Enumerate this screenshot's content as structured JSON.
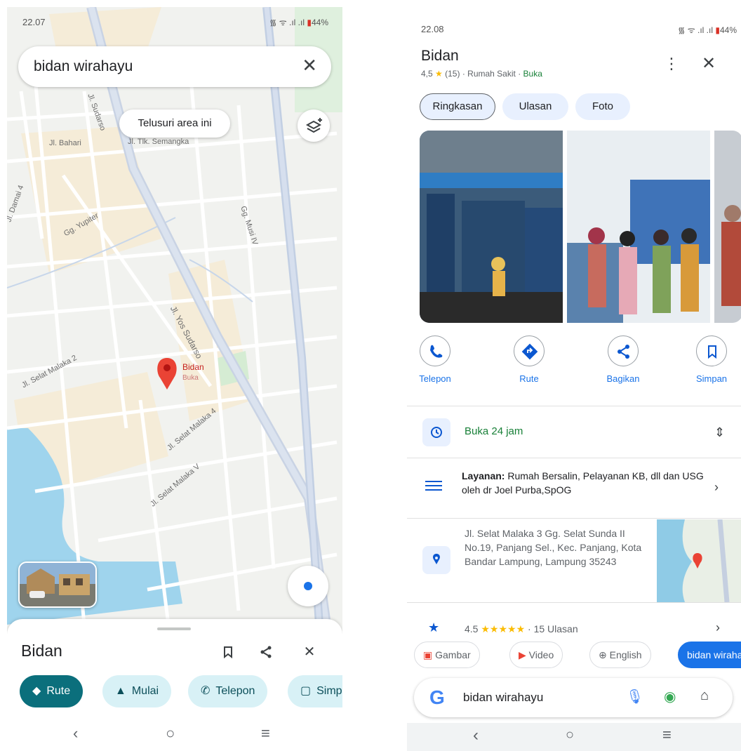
{
  "left": {
    "status": {
      "time": "22.07",
      "icons": "᯾ ᯤ .ıl .ıl",
      "battery": "44%"
    },
    "search": {
      "query": "bidan wirahayu"
    },
    "search_area_label": "Telusuri area ini",
    "street_labels": [
      "Jl. Bahari",
      "Jl. Tlk. Semangka",
      "Gg. Yupiter",
      "Gg. Musi IV",
      "Jl. Yos Sudarso",
      "Jl. Selat Malaka 2",
      "Jl. Selat Malaka 4",
      "Jl. Selat Malaka V",
      "Jl. Selat Malaka",
      "Jl. Damai 4",
      "Jl. Sudarso"
    ],
    "pin": {
      "name": "Bidan",
      "status": "Buka"
    },
    "sheet": {
      "title": "Bidan",
      "chips": [
        "Rute",
        "Mulai",
        "Telepon",
        "Simpan"
      ]
    }
  },
  "right": {
    "status": {
      "time": "22.08",
      "icons": "᯾ ᯤ .ıl .ıl",
      "battery": "44%"
    },
    "place": {
      "name": "Bidan",
      "rating": "4,5",
      "reviews_count": "(15)",
      "category": "Rumah Sakit",
      "open_status": "Buka"
    },
    "tabs": [
      "Ringkasan",
      "Ulasan",
      "Foto"
    ],
    "actions": [
      "Telepon",
      "Rute",
      "Bagikan",
      "Simpan"
    ],
    "hours": "Buka 24 jam",
    "services_label": "Layanan:",
    "services_text": "Rumah Bersalin, Pelayanan KB, dll dan USG oleh dr Joel Purba,SpOG",
    "address": "Jl. Selat Malaka 3 Gg. Selat Sunda II No.19, Panjang Sel., Kec. Panjang, Kota Bandar Lampung, Lampung 35243",
    "review_summary": {
      "rating": "4.5",
      "stars": "★★★★★",
      "text": "15 Ulasan"
    },
    "bottom_chips": [
      "Gambar",
      "Video",
      "English",
      "bidan wirahayu"
    ],
    "google_search": "bidan wirahayu"
  },
  "colors": {
    "accent_teal": "#0b6f7c",
    "google_blue": "#1a73e8",
    "pin_red": "#d93025",
    "open_green": "#188038"
  }
}
